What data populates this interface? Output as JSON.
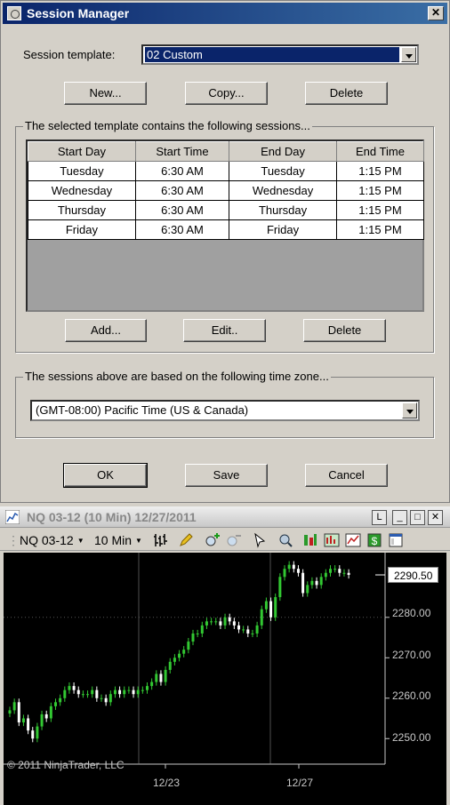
{
  "session_manager": {
    "title": "Session Manager",
    "close_glyph": "✕",
    "template_label": "Session template:",
    "template_value": "02 Custom",
    "buttons_top": {
      "new": "New...",
      "copy": "Copy...",
      "delete": "Delete"
    },
    "sessions_group_label": "The selected template contains the following sessions...",
    "columns": [
      "Start Day",
      "Start Time",
      "End Day",
      "End Time"
    ],
    "rows": [
      [
        "Tuesday",
        "6:30 AM",
        "Tuesday",
        "1:15 PM"
      ],
      [
        "Wednesday",
        "6:30 AM",
        "Wednesday",
        "1:15 PM"
      ],
      [
        "Thursday",
        "6:30 AM",
        "Thursday",
        "1:15 PM"
      ],
      [
        "Friday",
        "6:30 AM",
        "Friday",
        "1:15 PM"
      ]
    ],
    "buttons_grid": {
      "add": "Add...",
      "edit": "Edit..",
      "delete": "Delete"
    },
    "timezone_group_label": "The sessions above are based on the following time zone...",
    "timezone_value": "(GMT-08:00) Pacific Time (US & Canada)",
    "buttons_bottom": {
      "ok": "OK",
      "save": "Save",
      "cancel": "Cancel"
    }
  },
  "chart_window": {
    "title": "NQ 03-12 (10 Min)  12/27/2011",
    "window_buttons": [
      "L",
      "_",
      "□",
      "✕"
    ],
    "toolbar": {
      "instrument": "NQ 03-12",
      "interval": "10 Min"
    },
    "toolbar_icons": [
      "bar-style-icon",
      "pencil-icon",
      "zoom-in-icon",
      "zoom-out-icon",
      "cursor-icon",
      "magnifier-icon",
      "indicator-icon",
      "strategy-icon",
      "chart-icon",
      "dollar-icon",
      "properties-icon"
    ],
    "copyright": "© 2011 NinjaTrader, LLC",
    "last_price": "2290.50",
    "colors": {
      "up": "#32c832",
      "down": "#ffffff",
      "background": "#000000"
    }
  },
  "chart_data": {
    "type": "candlestick",
    "x_labels": [
      "12/23",
      "12/27"
    ],
    "y_ticks": [
      "2250.00",
      "2260.00",
      "2270.00",
      "2280.00"
    ],
    "ylim": [
      2245,
      2296
    ],
    "last_price": 2290.5,
    "grid": "vertical session lines only",
    "closes": [
      2257,
      2259,
      2254,
      2255,
      2252,
      2250,
      2253,
      2256,
      2255,
      2258,
      2259,
      2260,
      2262,
      2263,
      2262,
      2261,
      2261,
      2261,
      2262,
      2260,
      2260,
      2259,
      2261,
      2262,
      2261,
      2262,
      2262,
      2261,
      2262,
      2262,
      2263,
      2264,
      2266,
      2264,
      2267,
      2269,
      2270,
      2271,
      2272,
      2274,
      2276,
      2276,
      2278,
      2279,
      2279,
      2279,
      2278,
      2280,
      2279,
      2278,
      2277,
      2277,
      2276,
      2276,
      2278,
      2282,
      2284,
      2280,
      2285,
      2290,
      2292,
      2293,
      2292,
      2291,
      2286,
      2288,
      2289,
      2288,
      2290,
      2291,
      2292,
      2292,
      2291,
      2291,
      2290.5
    ]
  }
}
